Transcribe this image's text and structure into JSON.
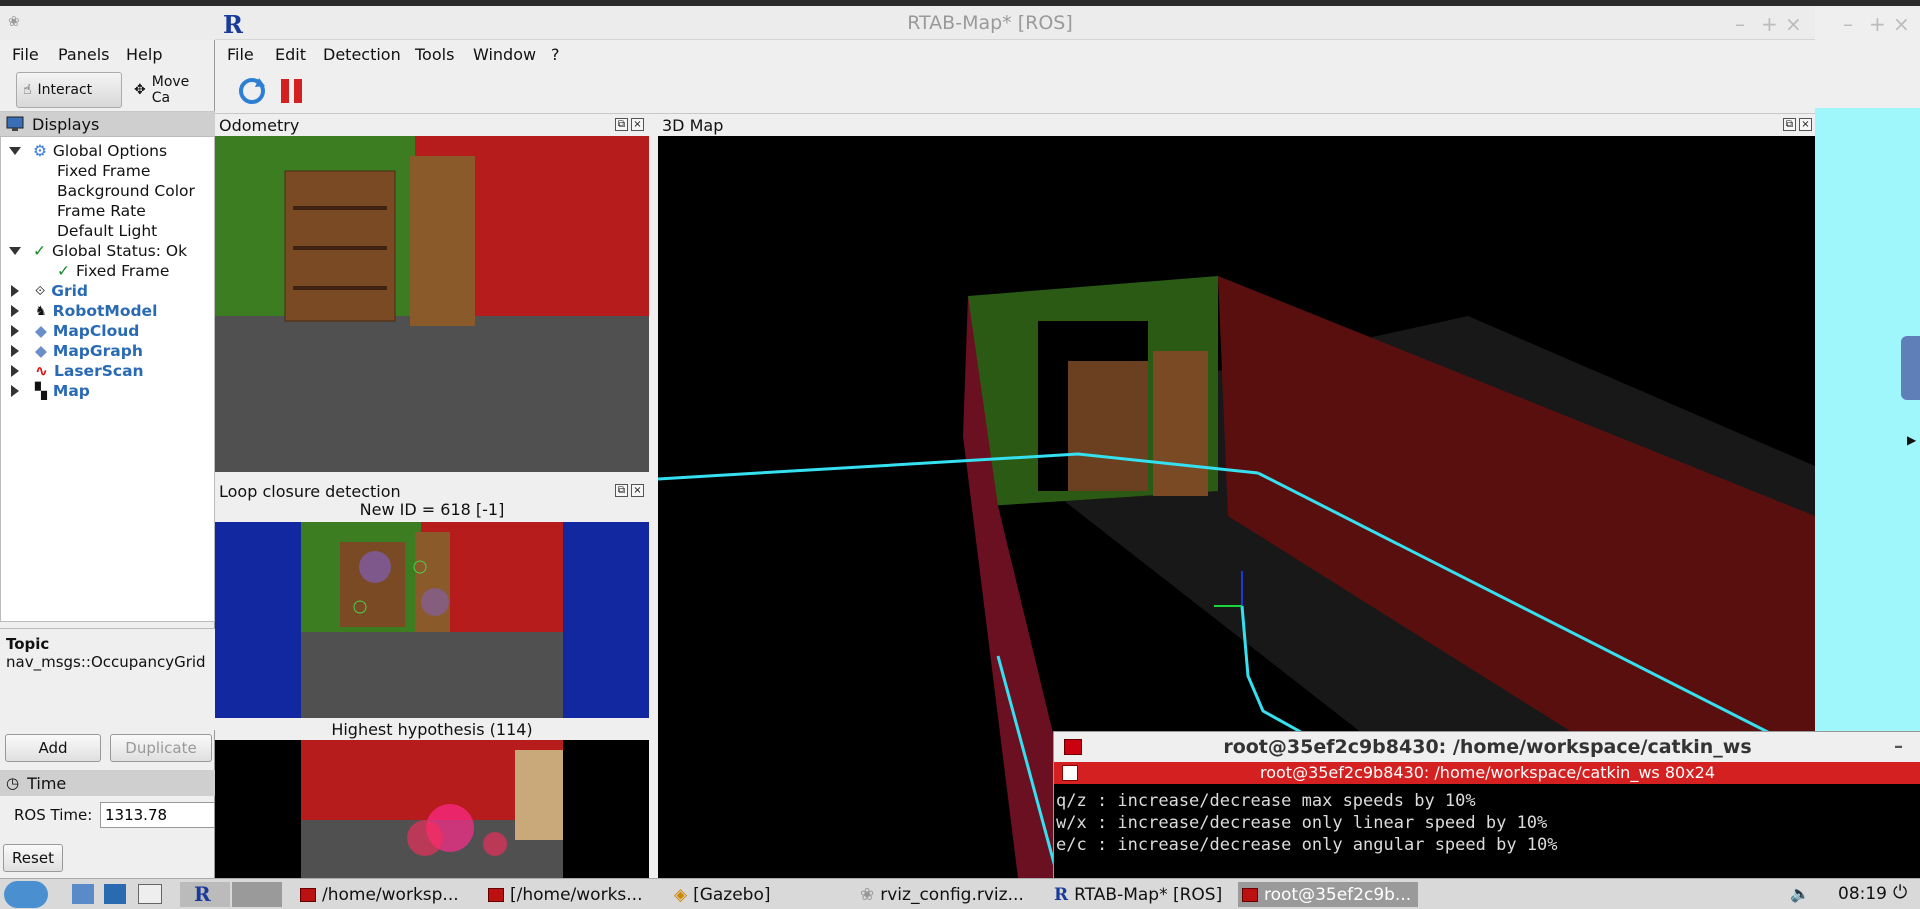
{
  "rviz": {
    "menu": [
      "File",
      "Panels",
      "Help"
    ],
    "toolbar": {
      "interact": "Interact",
      "move_camera": "Move Ca"
    },
    "displays_title": "Displays",
    "tree": [
      {
        "label": "Global Options",
        "level": 0,
        "expand": "down"
      },
      {
        "label": "Fixed Frame",
        "level": 1
      },
      {
        "label": "Background Color",
        "level": 1
      },
      {
        "label": "Frame Rate",
        "level": 1
      },
      {
        "label": "Default Light",
        "level": 1
      },
      {
        "label": "Global Status: Ok",
        "level": 0,
        "expand": "down"
      },
      {
        "label": "Fixed Frame",
        "level": 1
      },
      {
        "label": "Grid",
        "level": 0,
        "expand": "right"
      },
      {
        "label": "RobotModel",
        "level": 0,
        "expand": "right"
      },
      {
        "label": "MapCloud",
        "level": 0,
        "expand": "right"
      },
      {
        "label": "MapGraph",
        "level": 0,
        "expand": "right"
      },
      {
        "label": "LaserScan",
        "level": 0,
        "expand": "right"
      },
      {
        "label": "Map",
        "level": 0,
        "expand": "right"
      }
    ],
    "topic_label": "Topic",
    "topic_value": "nav_msgs::OccupancyGrid t",
    "add_label": "Add",
    "duplicate_label": "Duplicate",
    "time_title": "Time",
    "ros_time_label": "ROS Time:",
    "ros_time_value": "1313.78",
    "reset_label": "Reset"
  },
  "rtab": {
    "title": "RTAB-Map* [ROS]",
    "menu": [
      "File",
      "Edit",
      "Detection",
      "Tools",
      "Window",
      "?"
    ],
    "odometry_title": "Odometry",
    "loop_title": "Loop closure detection",
    "new_id": "New ID = 618 [-1]",
    "highest": "Highest hypothesis (114)",
    "map_title": "3D Map"
  },
  "terminal": {
    "title": "root@35ef2c9b8430: /home/workspace/catkin_ws",
    "tab": "root@35ef2c9b8430: /home/workspace/catkin_ws 80x24",
    "lines": [
      "q/z : increase/decrease max speeds by 10%",
      "w/x : increase/decrease only linear speed by 10%",
      "e/c : increase/decrease only angular speed by 10%"
    ]
  },
  "taskbar": {
    "items": [
      "/home/worksp...",
      "[/home/works...",
      "[Gazebo]",
      "rviz_config.rviz...",
      "RTAB-Map* [ROS]",
      "root@35ef2c9b..."
    ],
    "clock": "08:19"
  }
}
